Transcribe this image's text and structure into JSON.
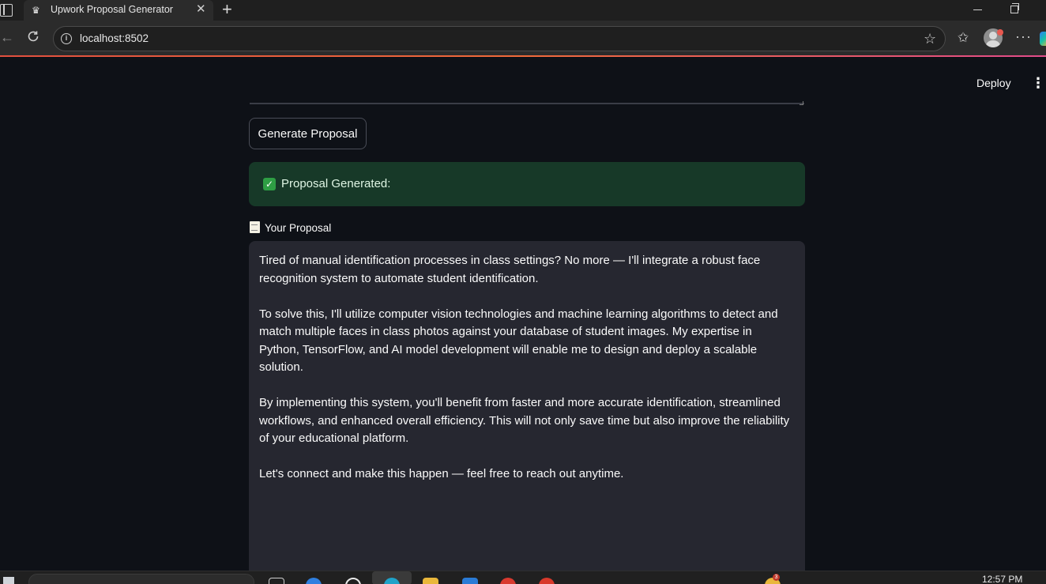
{
  "browser": {
    "tab_title": "Upwork Proposal Generator",
    "tab_close_glyph": "✕",
    "new_tab_glyph": "+",
    "url": "localhost:8502"
  },
  "app": {
    "deploy_label": "Deploy",
    "menu_glyph": "⋮",
    "generate_button_label": "Generate Proposal",
    "success_message": "Proposal Generated:",
    "proposal_label": "Your Proposal",
    "proposal_paragraphs": [
      "Tired of manual identification processes in class settings? No more — I'll integrate a robust face recognition system to automate student identification.",
      "To solve this, I'll utilize computer vision technologies and machine learning algorithms to detect and match multiple faces in class photos against your database of student images. My expertise in Python, TensorFlow, and AI model development will enable me to design and deploy a scalable solution.",
      "By implementing this system, you'll benefit from faster and more accurate identification, streamlined workflows, and enhanced overall efficiency. This will not only save time but also improve the reliability of your educational platform.",
      "Let's connect and make this happen — feel free to reach out anytime."
    ]
  },
  "taskbar": {
    "clock": "12:57 PM",
    "badge_count": "3"
  },
  "colors": {
    "app_background": "#0e1117",
    "success_background": "#173928",
    "text_area_background": "#262730",
    "accent_gradient_start": "#e2503f"
  }
}
